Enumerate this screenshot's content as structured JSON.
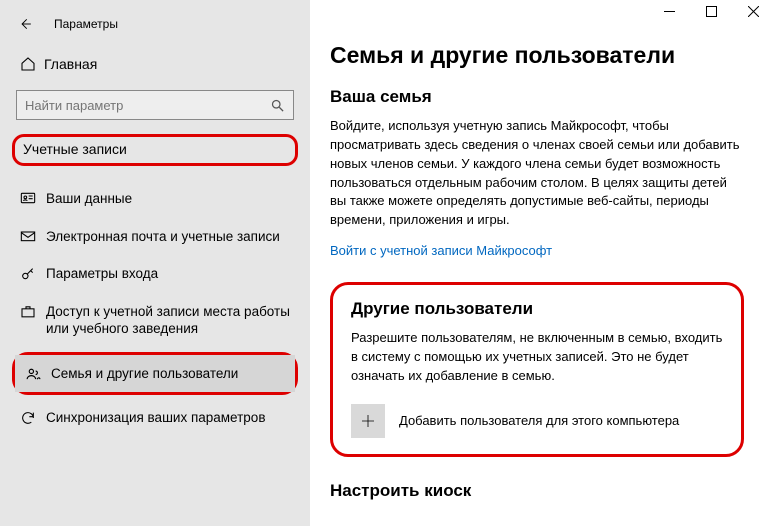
{
  "window": {
    "title": "Параметры"
  },
  "sidebar": {
    "home": "Главная",
    "searchPlaceholder": "Найти параметр",
    "category": "Учетные записи",
    "items": [
      {
        "label": "Ваши данные"
      },
      {
        "label": "Электронная почта и учетные записи"
      },
      {
        "label": "Параметры входа"
      },
      {
        "label": "Доступ к учетной записи места работы или учебного заведения"
      },
      {
        "label": "Семья и другие пользователи"
      },
      {
        "label": "Синхронизация ваших параметров"
      }
    ]
  },
  "page": {
    "heading": "Семья и другие пользователи",
    "family": {
      "title": "Ваша семья",
      "desc": "Войдите, используя учетную запись Майкрософт, чтобы просматривать здесь сведения о членах своей семьи или добавить новых членов семьи. У каждого члена семьи будет возможность пользоваться отдельным рабочим столом. В целях защиты детей вы также можете определять допустимые веб-сайты, периоды времени, приложения и игры.",
      "link": "Войти с учетной записи Майкрософт"
    },
    "others": {
      "title": "Другие пользователи",
      "desc": "Разрешите пользователям, не включенным в семью, входить в систему с помощью их учетных записей. Это не будет означать их добавление в семью.",
      "add": "Добавить пользователя для этого компьютера"
    },
    "kiosk": {
      "title": "Настроить киоск"
    }
  }
}
